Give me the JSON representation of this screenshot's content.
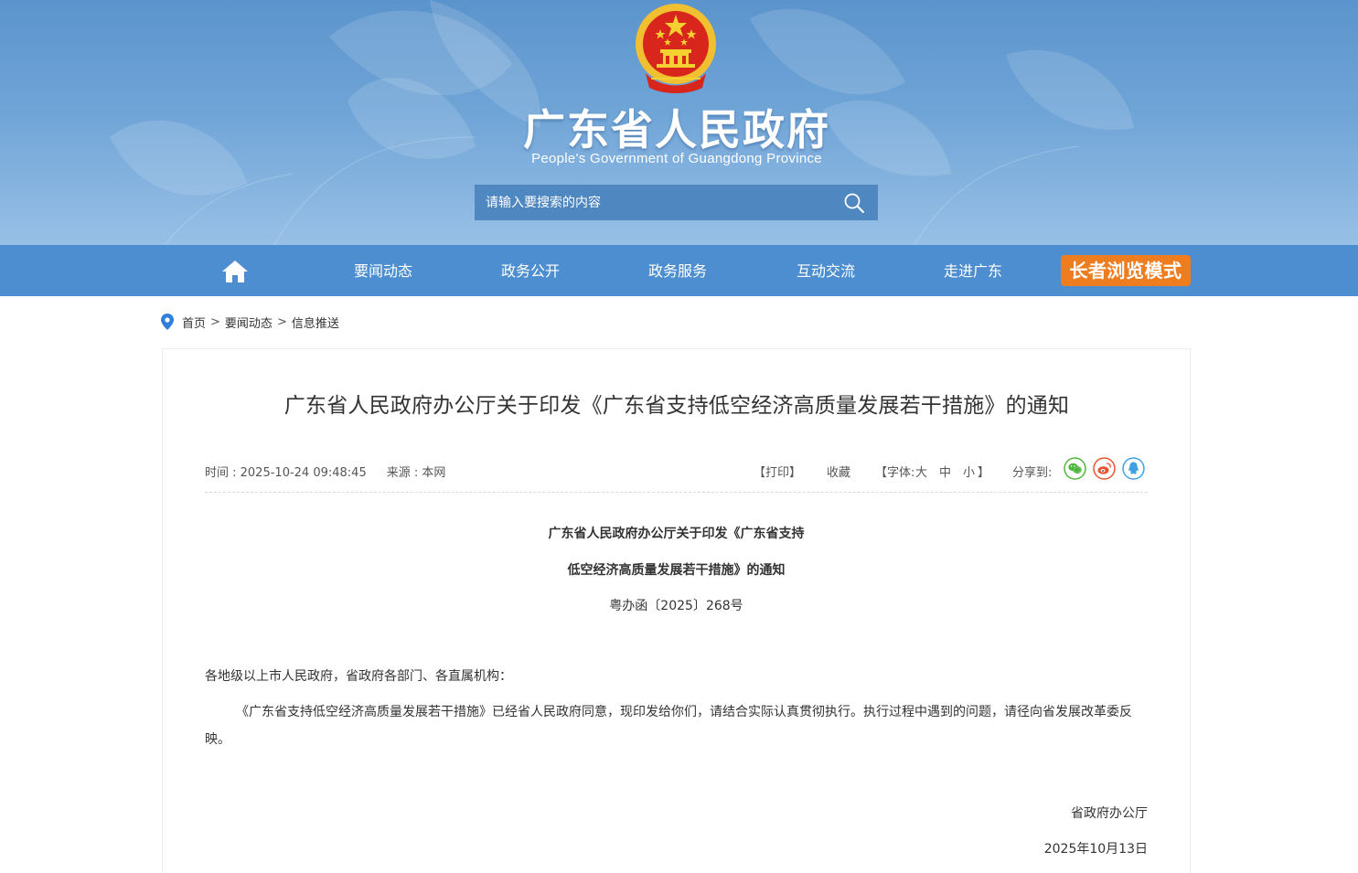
{
  "header": {
    "title": "广东省人民政府",
    "subtitle": "People's Government of Guangdong Province",
    "search_placeholder": "请输入要搜索的内容"
  },
  "nav": {
    "items": [
      "要闻动态",
      "政务公开",
      "政务服务",
      "互动交流",
      "走进广东"
    ],
    "elder_mode": "长者浏览模式"
  },
  "breadcrumb": {
    "items": [
      "首页",
      "要闻动态",
      "信息推送"
    ],
    "separator": ">"
  },
  "article": {
    "title": "广东省人民政府办公厅关于印发《广东省支持低空经济高质量发展若干措施》的通知",
    "time_label": "时间 : 2025-10-24 09:48:45",
    "source_label": "来源 : 本网",
    "tools": {
      "print": "【打印】",
      "favorite": "收藏",
      "font_label": "【字体:",
      "font_large": "大",
      "font_medium": "中",
      "font_small": "小",
      "font_close": "】",
      "share_label": "分享到:"
    },
    "doc_title_line1": "广东省人民政府办公厅关于印发《广东省支持",
    "doc_title_line2": "低空经济高质量发展若干措施》的通知",
    "doc_number": "粤办函〔2025〕268号",
    "salutation": "各地级以上市人民政府，省政府各部门、各直属机构：",
    "paragraph": "《广东省支持低空经济高质量发展若干措施》已经省人民政府同意，现印发给你们，请结合实际认真贯彻执行。执行过程中遇到的问题，请径向省发展改革委反映。",
    "signature": "省政府办公厅",
    "date": "2025年10月13日"
  },
  "colors": {
    "nav_bg": "#4c8ecf",
    "elder_mode_bg": "#ee7d1f",
    "wechat": "#4fb63c",
    "weibo": "#e9532d",
    "qq": "#3fa1e4"
  }
}
